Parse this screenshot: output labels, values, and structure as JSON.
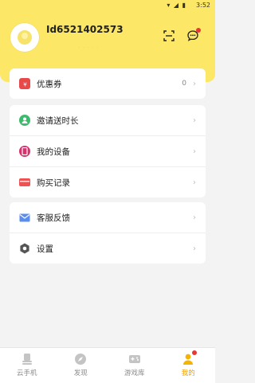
{
  "status_bar": {
    "time": "3:52"
  },
  "profile": {
    "user_id": "Id6521402573",
    "sub_text": "· · · · ·"
  },
  "menu_group_1": [
    {
      "label": "优惠券",
      "value": "0",
      "icon": "coupon-icon"
    }
  ],
  "menu_group_2": [
    {
      "label": "邀请送时长",
      "icon": "invite-user-icon"
    },
    {
      "label": "我的设备",
      "icon": "device-icon"
    },
    {
      "label": "购买记录",
      "icon": "card-icon"
    }
  ],
  "menu_group_3": [
    {
      "label": "客服反馈",
      "icon": "mail-icon"
    },
    {
      "label": "设置",
      "icon": "gear-icon"
    }
  ],
  "tabs": [
    {
      "label": "云手机",
      "icon": "phone-stack-icon",
      "active": false
    },
    {
      "label": "发现",
      "icon": "compass-icon",
      "active": false
    },
    {
      "label": "游戏库",
      "icon": "gamepad-icon",
      "active": false
    },
    {
      "label": "我的",
      "icon": "user-icon",
      "active": true
    }
  ],
  "colors": {
    "header_yellow": "#fce766",
    "active_tab": "#f0a000",
    "badge_red": "#e53935",
    "coupon_red": "#e84a4a",
    "invite_green": "#3dbb6c",
    "device_magenta": "#d6336c",
    "card_red": "#f05252",
    "mail_blue": "#5b8def",
    "gear_gray": "#555555"
  }
}
